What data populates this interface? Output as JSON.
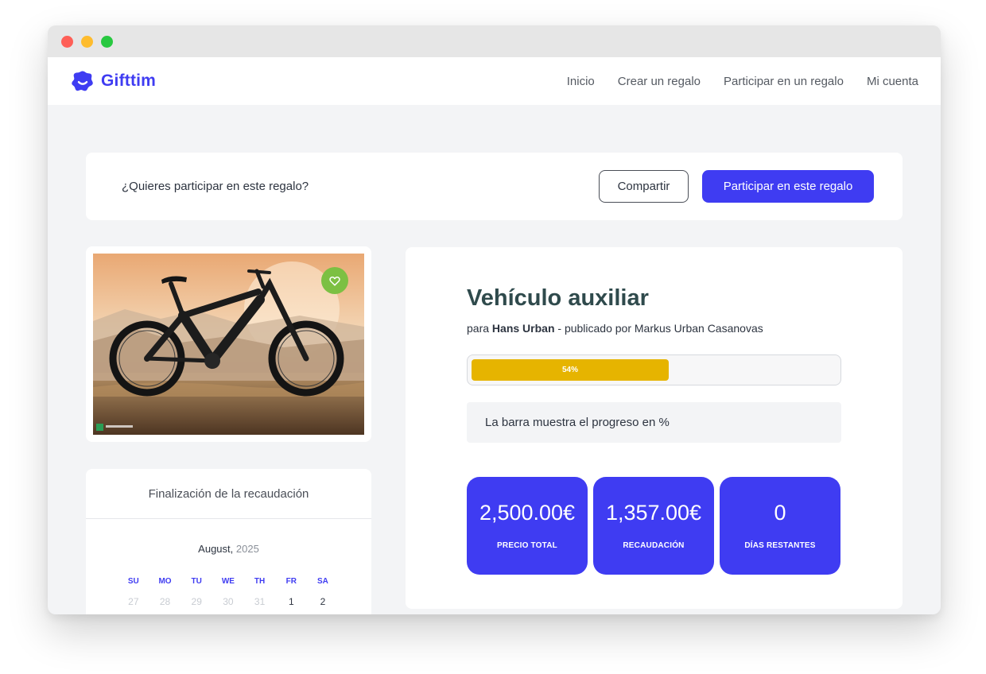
{
  "app": {
    "name": "Gifttim"
  },
  "nav": {
    "items": [
      "Inicio",
      "Crear un regalo",
      "Participar en un regalo",
      "Mi cuenta"
    ]
  },
  "prompt": {
    "question": "¿Quieres participar en este regalo?",
    "share_label": "Compartir",
    "join_label": "Participar en este regalo"
  },
  "gift": {
    "title": "Vehículo auxiliar",
    "for_prefix": "para",
    "recipient": "Hans Urban",
    "published_by": "- publicado por Markus Urban Casanovas",
    "progress_percent": 54,
    "progress_label": "54%",
    "progress_note": "La barra muestra el progreso en %"
  },
  "stats": [
    {
      "value": "2,500.00€",
      "label": "PRECIO TOTAL"
    },
    {
      "value": "1,357.00€",
      "label": "RECAUDACIÓN"
    },
    {
      "value": "0",
      "label": "DÍAS RESTANTES"
    }
  ],
  "calendar": {
    "heading": "Finalización de la recaudación",
    "month": "August,",
    "year": "2025",
    "weekdays": [
      "SU",
      "MO",
      "TU",
      "WE",
      "TH",
      "FR",
      "SA"
    ],
    "first_week": [
      {
        "day": "27",
        "muted": true
      },
      {
        "day": "28",
        "muted": true
      },
      {
        "day": "29",
        "muted": true
      },
      {
        "day": "30",
        "muted": true
      },
      {
        "day": "31",
        "muted": true
      },
      {
        "day": "1",
        "muted": false
      },
      {
        "day": "2",
        "muted": false
      }
    ]
  },
  "colors": {
    "brand": "#3f3cf2",
    "progress": "#e6b400",
    "favorite": "#7cc043",
    "title": "#2f4a4c"
  },
  "icons": {
    "logo": "smiley-blob-icon",
    "favorite": "heart-icon"
  }
}
